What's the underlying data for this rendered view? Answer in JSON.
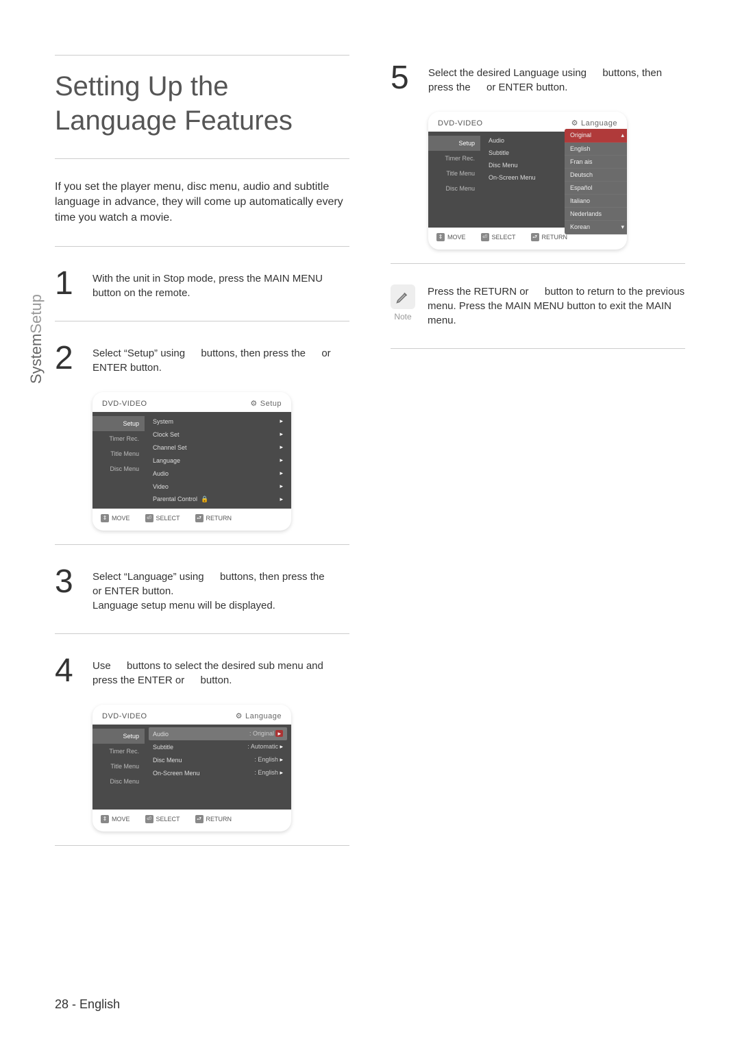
{
  "sidebar": {
    "label_a": "System",
    "label_b": "Setup"
  },
  "title": "Setting Up the Language Features",
  "intro": "If you set the player menu, disc menu, audio and subtitle language in advance, they will come up automatically every time you watch a movie.",
  "steps": {
    "s1": {
      "num": "1",
      "text": "With the unit in Stop mode, press the MAIN MENU button on the remote."
    },
    "s2": {
      "num": "2",
      "text": "Select “Setup” using   buttons, then press the   or ENTER button."
    },
    "s3": {
      "num": "3",
      "text_a": "Select “Language” using   buttons, then press the   or ENTER button.",
      "text_b": "Language setup menu will be displayed."
    },
    "s4": {
      "num": "4",
      "text": "Use   buttons to select the desired sub menu and press the ENTER or   button."
    },
    "s5": {
      "num": "5",
      "text": "Select the desired Language using   buttons, then press the   or ENTER button."
    }
  },
  "note": {
    "label": "Note",
    "text": "Press the RETURN or   button to return to the previous menu. Press the MAIN MENU button to exit the MAIN menu."
  },
  "footer": {
    "page": "28 -",
    "lang": "English"
  },
  "panel_common": {
    "header_title": "DVD-VIDEO",
    "left_items": [
      "Setup",
      "Timer Rec.",
      "Title Menu",
      "Disc Menu"
    ],
    "footer": {
      "move": "MOVE",
      "select": "SELECT",
      "return": "RETURN"
    }
  },
  "panel2": {
    "crumb": "Setup",
    "options": [
      "System",
      "Clock Set",
      "Channel Set",
      "Language",
      "Audio",
      "Video",
      "Parental Control"
    ]
  },
  "panel4": {
    "crumb": "Language",
    "options": [
      {
        "label": "Audio",
        "val": ": Original"
      },
      {
        "label": "Subtitle",
        "val": ": Automatic"
      },
      {
        "label": "Disc Menu",
        "val": ": English"
      },
      {
        "label": "On-Screen Menu",
        "val": ": English"
      }
    ]
  },
  "panel5": {
    "crumb": "Language",
    "options": [
      {
        "label": "Audio"
      },
      {
        "label": "Subtitle"
      },
      {
        "label": "Disc Menu"
      },
      {
        "label": "On-Screen Menu"
      }
    ],
    "lang_options": [
      "Original",
      "English",
      "Fran ais",
      "Deutsch",
      "Español",
      "Italiano",
      "Nederlands",
      "Korean"
    ]
  }
}
